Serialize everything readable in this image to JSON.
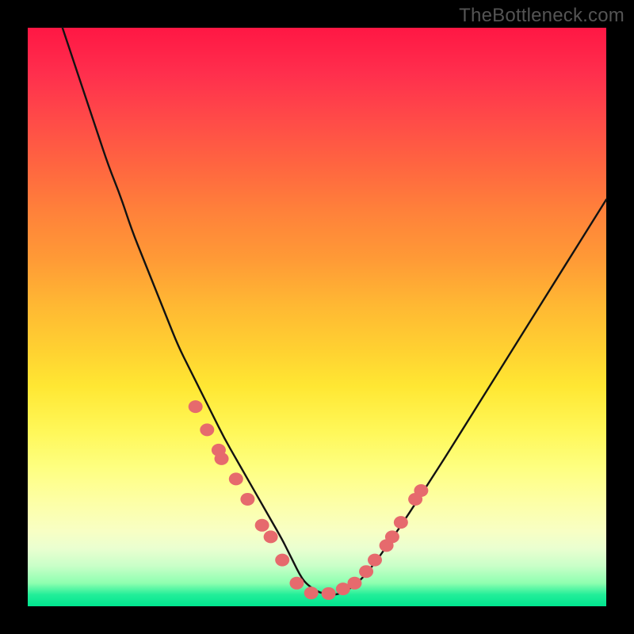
{
  "watermark": "TheBottleneck.com",
  "colors": {
    "frame": "#000000",
    "curve_stroke": "#121212",
    "dot_fill": "#e66a6d",
    "dot_stroke": "#c94f56"
  },
  "chart_data": {
    "type": "line",
    "title": "",
    "xlabel": "",
    "ylabel": "",
    "xlim": [
      0,
      100
    ],
    "ylim": [
      0,
      100
    ],
    "series": [
      {
        "name": "curve",
        "x": [
          6,
          8,
          10,
          12,
          14,
          16,
          18,
          20,
          22,
          24,
          26,
          28,
          30,
          32,
          34,
          36,
          38,
          40,
          42,
          44,
          45,
          46,
          47,
          48,
          50,
          52,
          53,
          54,
          56,
          58,
          60,
          62,
          64,
          66,
          68,
          70,
          72,
          74,
          76,
          78,
          80,
          82,
          84,
          86,
          88,
          90,
          92,
          94,
          96,
          98,
          100
        ],
        "y": [
          100,
          94,
          88,
          82,
          76,
          71,
          65,
          60,
          55,
          50,
          45,
          41,
          37,
          33,
          29,
          25.5,
          22,
          18.5,
          15,
          11.5,
          9.5,
          7.5,
          5.5,
          4,
          2.5,
          2,
          2,
          2.2,
          3.2,
          5,
          7.5,
          10.3,
          13.2,
          16.2,
          19.3,
          22.4,
          25.5,
          28.7,
          31.9,
          35.1,
          38.3,
          41.5,
          44.7,
          47.9,
          51.1,
          54.3,
          57.5,
          60.7,
          63.9,
          67.1,
          70.3
        ]
      },
      {
        "name": "dots",
        "x": [
          29,
          31,
          33,
          33.5,
          36,
          38,
          40.5,
          42,
          44,
          46.5,
          49,
          52,
          54.5,
          56.5,
          58.5,
          60,
          62,
          63,
          64.5,
          67,
          68
        ],
        "y": [
          34.5,
          30.5,
          27,
          25.5,
          22,
          18.5,
          14,
          12,
          8,
          4,
          2.3,
          2.2,
          3,
          4,
          6,
          8,
          10.5,
          12,
          14.5,
          18.5,
          20
        ]
      }
    ]
  }
}
